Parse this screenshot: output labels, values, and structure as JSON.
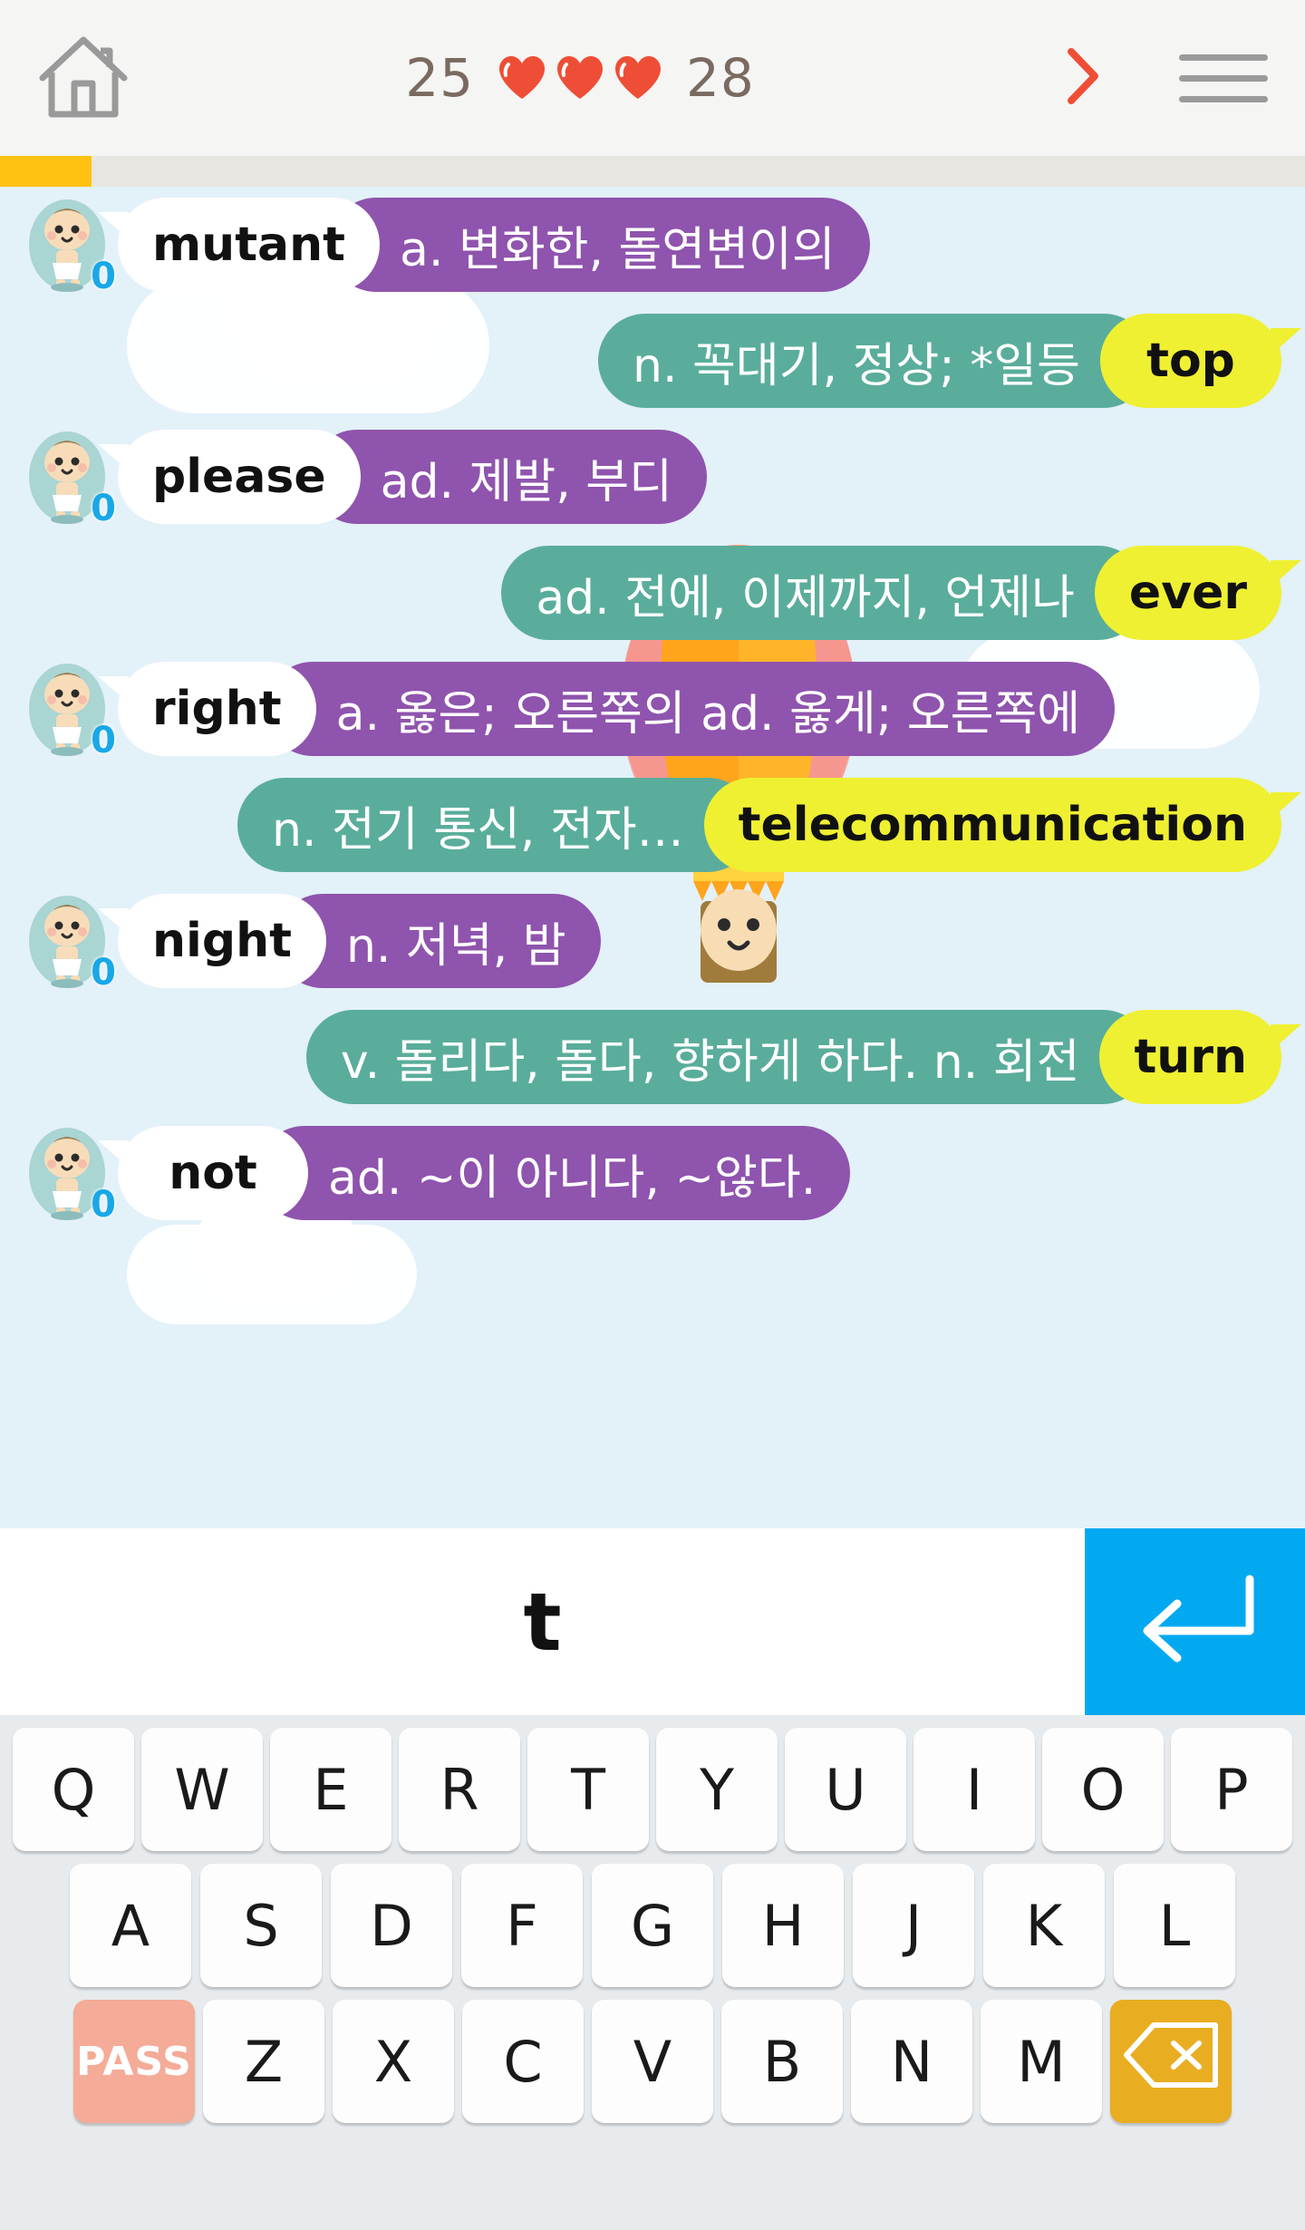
{
  "header": {
    "home_icon": "home-icon",
    "score_left": "25",
    "hearts": 3,
    "heart_icon": "heart-icon",
    "score_right": "28",
    "next_icon": "chevron-right-icon",
    "menu_icon": "hamburger-menu-icon",
    "accent_red": "#ef4e36",
    "text_brown": "#7a6a60"
  },
  "progress": {
    "percent": 7,
    "fill_color": "#ffc212",
    "track_color": "#e7e6e1"
  },
  "board": {
    "background": "#e3f1f9",
    "avatar_badge": "0",
    "avatar_name": "baby-avatar",
    "rows": [
      {
        "side": "left",
        "word": "mutant",
        "definition": "a. 변화한, 돌연변이의"
      },
      {
        "side": "right",
        "word": "top",
        "definition": "n. 꼭대기, 정상; *일등"
      },
      {
        "side": "left",
        "word": "please",
        "definition": "ad. 제발, 부디"
      },
      {
        "side": "right",
        "word": "ever",
        "definition": "ad. 전에, 이제까지, 언제나"
      },
      {
        "side": "left",
        "word": "right",
        "definition": "a. 옳은; 오른쪽의   ad. 옳게; 오른쪽에"
      },
      {
        "side": "right",
        "word": "telecommunication",
        "definition": "n. 전기 통신, 전자…"
      },
      {
        "side": "left",
        "word": "night",
        "definition": "n. 저녁, 밤"
      },
      {
        "side": "right",
        "word": "turn",
        "definition": "v. 돌리다, 돌다, 향하게 하다.   n. 회전"
      },
      {
        "side": "left",
        "word": "not",
        "definition": "ad. ~이 아니다, ~않다."
      }
    ],
    "colors": {
      "word_left_bg": "#ffffff",
      "word_right_bg": "#eff032",
      "def_left_bg": "#8f54ad",
      "def_right_bg": "#5aad9b"
    }
  },
  "input": {
    "typed_text": "t",
    "placeholder": "",
    "enter_icon": "enter-return-icon",
    "enter_bg": "#03a9f0"
  },
  "keyboard": {
    "row1": [
      "Q",
      "W",
      "E",
      "R",
      "T",
      "Y",
      "U",
      "I",
      "O",
      "P"
    ],
    "row2": [
      "A",
      "S",
      "D",
      "F",
      "G",
      "H",
      "J",
      "K",
      "L"
    ],
    "row3_letters": [
      "Z",
      "X",
      "C",
      "V",
      "B",
      "N",
      "M"
    ],
    "pass_label": "PASS",
    "pass_color": "#f4ab97",
    "backspace_icon": "backspace-icon",
    "backspace_color": "#e9ad22",
    "key_bg": "#fdfdfd",
    "background": "#e7ebed"
  }
}
